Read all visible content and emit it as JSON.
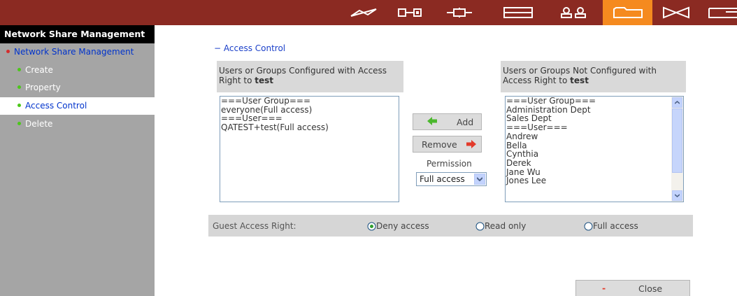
{
  "topbar": {
    "icons": [
      "quick-config-icon",
      "network-icon",
      "device-icon",
      "disk-icon",
      "users-icon",
      "share-folder-icon",
      "services-icon",
      "applications-icon"
    ],
    "active_icon": "share-folder-icon",
    "colors": {
      "bar": "#8b2a22",
      "active": "#f58a1f"
    }
  },
  "sidebar": {
    "header": "Network Share Management",
    "items": [
      {
        "label": "Network Share Management",
        "active": false
      },
      {
        "label": "Create",
        "active": false
      },
      {
        "label": "Property",
        "active": false
      },
      {
        "label": "Access Control",
        "active": true
      },
      {
        "label": "Delete",
        "active": false
      }
    ],
    "colors": {
      "bg": "#a5a5a5",
      "dot": "#4cc71a",
      "dot_top": "#d42d2d",
      "link": "#0033cc"
    }
  },
  "main": {
    "section_title": "− Access Control",
    "configured": {
      "header_text": "Users or Groups Configured with Access Right to ",
      "header_share": "test",
      "entries": [
        "===User Group===",
        "everyone(Full access)",
        "===User===",
        "QATEST+test(Full access)"
      ]
    },
    "not_configured": {
      "header_text": "Users or Groups Not Configured with Access Right to ",
      "header_share": "test",
      "entries": [
        "===User Group===",
        "Administration Dept",
        "Sales Dept",
        "===User===",
        "Andrew",
        "Bella",
        "Cynthia",
        "Derek",
        "Jane Wu",
        "Jones Lee"
      ]
    },
    "add_label": "Add",
    "remove_label": "Remove",
    "permission_label": "Permission",
    "permission_value": "Full access",
    "guest": {
      "label": "Guest Access Right:",
      "options": [
        {
          "label": "Deny access",
          "selected": true
        },
        {
          "label": "Read only",
          "selected": false
        },
        {
          "label": "Full access",
          "selected": false
        }
      ]
    },
    "close_label": "Close"
  }
}
